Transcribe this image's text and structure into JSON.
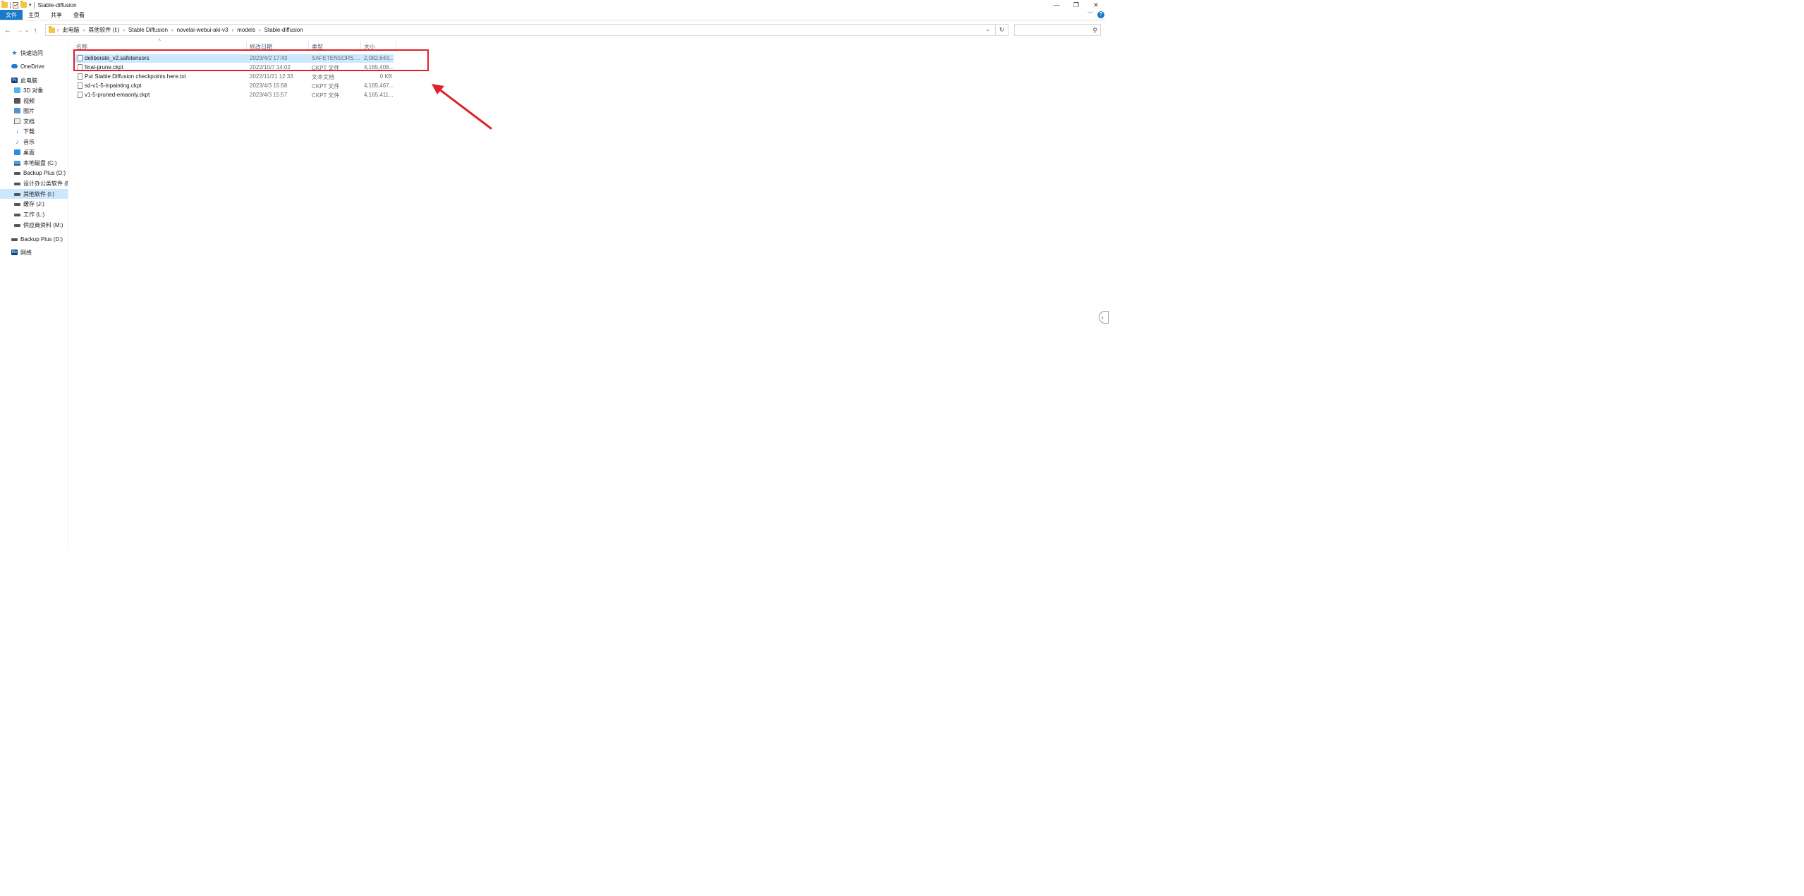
{
  "window": {
    "title": "Stable-diffusion",
    "controls": [
      "—",
      "❐",
      "✕"
    ]
  },
  "ribbon": {
    "tabs": [
      "文件",
      "主页",
      "共享",
      "查看"
    ],
    "help_glyph": "?"
  },
  "address": {
    "crumbs": [
      "此电脑",
      "其他软件 (I:)",
      "Stable Diffusion",
      "novelai-webui-aki-v3",
      "models",
      "Stable-diffusion"
    ],
    "search_placeholder": ""
  },
  "sidebar": {
    "items": [
      {
        "label": "快速访问",
        "icon": "star-icon"
      },
      {
        "label": "OneDrive",
        "icon": "cloud-icon"
      },
      {
        "label": "此电脑",
        "icon": "computer-icon"
      },
      {
        "label": "3D 对象",
        "icon": "3d-objects-icon"
      },
      {
        "label": "视频",
        "icon": "video-icon"
      },
      {
        "label": "图片",
        "icon": "pictures-icon"
      },
      {
        "label": "文档",
        "icon": "documents-icon"
      },
      {
        "label": "下载",
        "icon": "download-icon"
      },
      {
        "label": "音乐",
        "icon": "music-icon"
      },
      {
        "label": "桌面",
        "icon": "desktop-icon"
      },
      {
        "label": "本地磁盘 (C:)",
        "icon": "system-drive-icon"
      },
      {
        "label": "Backup Plus (D:)",
        "icon": "drive-icon"
      },
      {
        "label": "设计办公类软件 (E:",
        "icon": "drive-icon"
      },
      {
        "label": "其他软件 (I:)",
        "icon": "drive-icon",
        "selected": true
      },
      {
        "label": "缓存 (J:)",
        "icon": "drive-icon"
      },
      {
        "label": "工作 (L:)",
        "icon": "drive-icon"
      },
      {
        "label": "供应商资料 (M:)",
        "icon": "drive-icon"
      },
      {
        "label": "Backup Plus (D:)",
        "icon": "drive-icon"
      },
      {
        "label": "网络",
        "icon": "network-icon"
      }
    ]
  },
  "columns": {
    "name": "名称",
    "date": "修改日期",
    "type": "类型",
    "size": "大小"
  },
  "files": [
    {
      "name": "deliberate_v2.safetensors",
      "date": "2023/4/2 17:43",
      "type": "SAFETENSORS ...",
      "size": "2,082,643...",
      "selected": true
    },
    {
      "name": "final-prune.ckpt",
      "date": "2022/10/7 14:02",
      "type": "CKPT 文件",
      "size": "4,165,408..."
    },
    {
      "name": "Put Stable Diffusion checkpoints here.txt",
      "date": "2022/11/21 12:33",
      "type": "文本文档",
      "size": "0 KB"
    },
    {
      "name": "sd-v1-5-inpainting.ckpt",
      "date": "2023/4/3 15:58",
      "type": "CKPT 文件",
      "size": "4,165,467..."
    },
    {
      "name": "v1-5-pruned-emaonly.ckpt",
      "date": "2023/4/3 15:57",
      "type": "CKPT 文件",
      "size": "4,165,411..."
    }
  ],
  "colors": {
    "accent": "#1979ca",
    "selection": "#cce8ff",
    "annotation": "#e0212b"
  }
}
